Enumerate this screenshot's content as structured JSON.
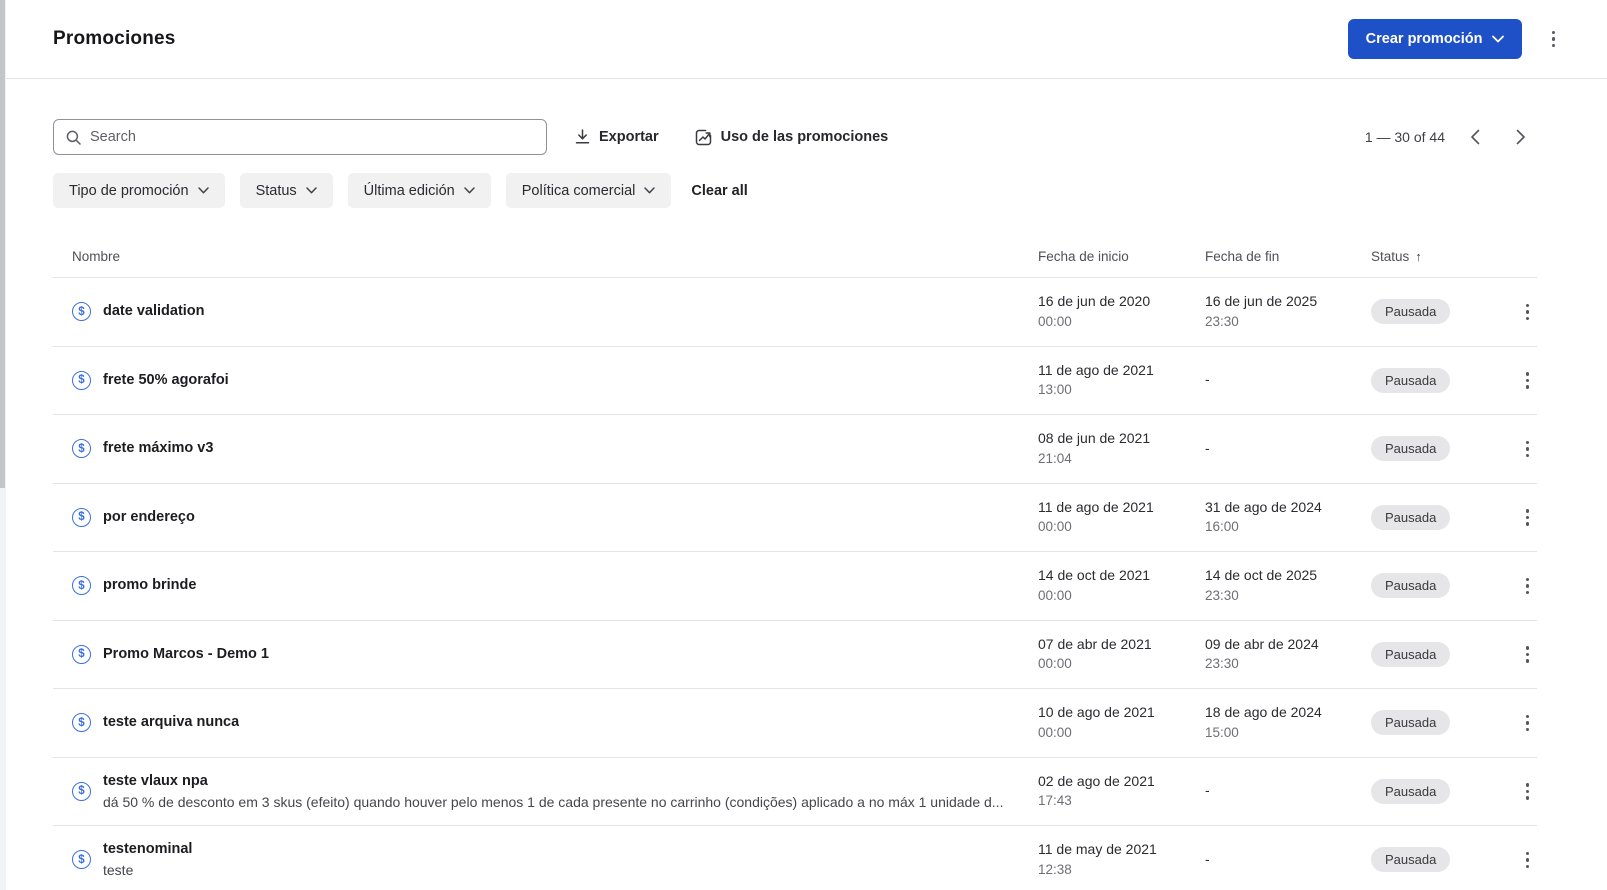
{
  "header": {
    "title": "Promociones",
    "create_button_label": "Crear promoción"
  },
  "toolbar": {
    "search_placeholder": "Search",
    "export_label": "Exportar",
    "usage_label": "Uso de las promociones",
    "pagination_label": "1 — 30 of 44"
  },
  "filters": {
    "type_label": "Tipo de promoción",
    "status_label": "Status",
    "last_edit_label": "Última edición",
    "trade_policy_label": "Política comercial",
    "clear_all_label": "Clear all"
  },
  "table": {
    "columns": {
      "name": "Nombre",
      "start": "Fecha de inicio",
      "end": "Fecha de fin",
      "status": "Status"
    },
    "sort_indicator": "↑",
    "rows": [
      {
        "name": "date validation",
        "desc": "",
        "start_date": "16 de jun de 2020",
        "start_time": "00:00",
        "end_date": "16 de jun de 2025",
        "end_time": "23:30",
        "status": "Pausada"
      },
      {
        "name": "frete 50% agorafoi",
        "desc": "",
        "start_date": "11 de ago de 2021",
        "start_time": "13:00",
        "end_date": "-",
        "end_time": "",
        "status": "Pausada"
      },
      {
        "name": "frete máximo v3",
        "desc": "",
        "start_date": "08 de jun de 2021",
        "start_time": "21:04",
        "end_date": "-",
        "end_time": "",
        "status": "Pausada"
      },
      {
        "name": "por endereço",
        "desc": "",
        "start_date": "11 de ago de 2021",
        "start_time": "00:00",
        "end_date": "31 de ago de 2024",
        "end_time": "16:00",
        "status": "Pausada"
      },
      {
        "name": "promo brinde",
        "desc": "",
        "start_date": "14 de oct de 2021",
        "start_time": "00:00",
        "end_date": "14 de oct de 2025",
        "end_time": "23:30",
        "status": "Pausada"
      },
      {
        "name": "Promo Marcos - Demo 1",
        "desc": "",
        "start_date": "07 de abr de 2021",
        "start_time": "00:00",
        "end_date": "09 de abr de 2024",
        "end_time": "23:30",
        "status": "Pausada"
      },
      {
        "name": "teste arquiva nunca",
        "desc": "",
        "start_date": "10 de ago de 2021",
        "start_time": "00:00",
        "end_date": "18 de ago de 2024",
        "end_time": "15:00",
        "status": "Pausada"
      },
      {
        "name": "teste vlaux npa",
        "desc": "dá 50 % de desconto em 3 skus (efeito) quando houver pelo menos 1 de cada presente no carrinho (condições) aplicado a no máx 1 unidade d...",
        "start_date": "02 de ago de 2021",
        "start_time": "17:43",
        "end_date": "-",
        "end_time": "",
        "status": "Pausada"
      },
      {
        "name": "testenominal",
        "desc": "teste",
        "start_date": "11 de may de 2021",
        "start_time": "12:38",
        "end_date": "-",
        "end_time": "",
        "status": "Pausada"
      }
    ]
  },
  "icons": {
    "dollar_symbol": "$",
    "colors": {
      "accent_blue": "#1e50c8",
      "icon_blue": "#3a6fe0",
      "badge_gray": "#e6e6e8"
    }
  }
}
